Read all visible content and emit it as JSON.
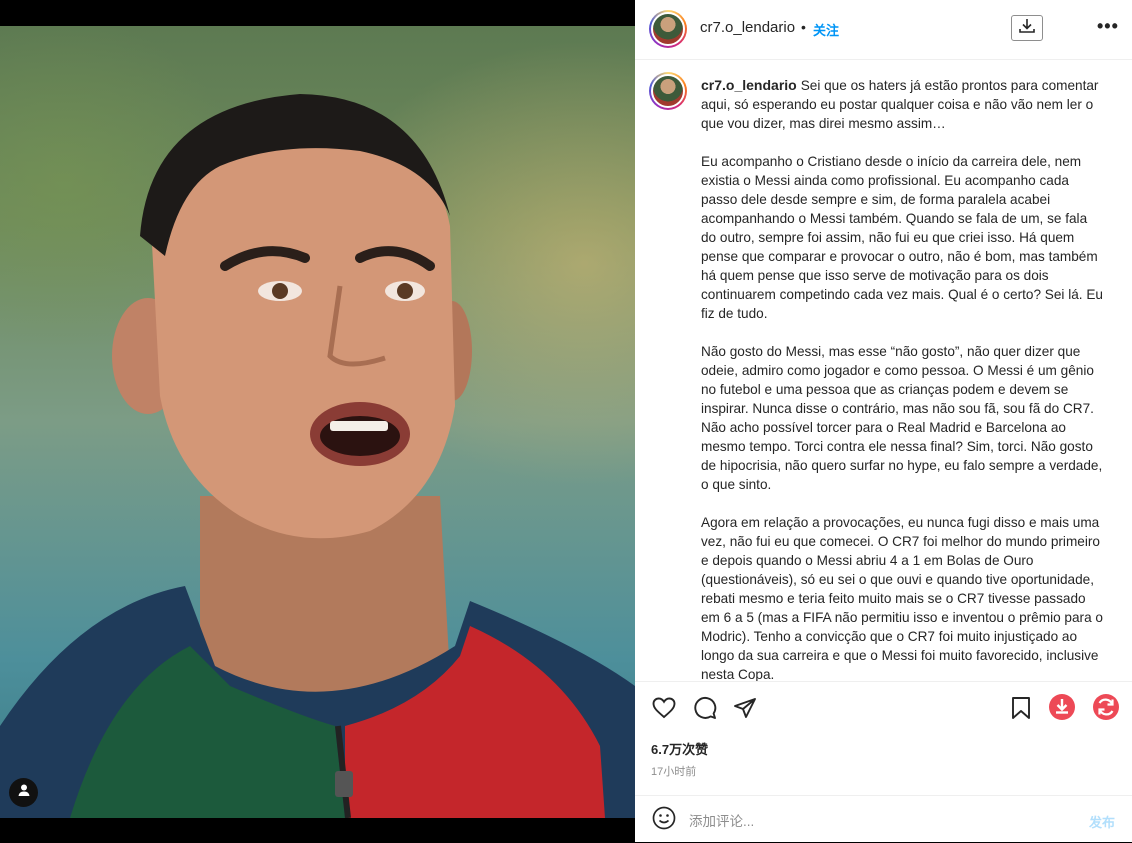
{
  "post": {
    "username": "cr7.o_lendario",
    "separator": "•",
    "follow_label": "关注",
    "more_label": "•••",
    "caption_paragraphs": [
      "Sei que os haters já estão prontos para comentar aqui, só esperando eu postar qualquer coisa e não vão nem ler o que vou dizer, mas direi mesmo assim…",
      "Eu acompanho o Cristiano desde o início da carreira dele, nem existia o Messi ainda como profissional. Eu acompanho cada passo dele desde sempre e sim, de forma paralela acabei acompanhando o Messi também. Quando se fala de um, se fala do outro, sempre foi assim, não fui eu que criei isso. Há quem pense que comparar e provocar o outro, não é bom, mas também há quem pense que isso serve de motivação para os dois continuarem competindo cada vez mais. Qual é o certo? Sei lá. Eu fiz de tudo.",
      "Não gosto do Messi, mas esse “não gosto”, não quer dizer que odeie, admiro como jogador e como pessoa. O Messi é um gênio no futebol e uma pessoa que as crianças podem e devem se inspirar. Nunca disse o contrário, mas não sou fã, sou fã do CR7. Não acho possível torcer para o Real Madrid e Barcelona ao mesmo tempo. Torci contra ele nessa final? Sim, torci. Não gosto de hipocrisia, não quero surfar no hype, eu falo sempre a verdade, o que sinto.",
      "Agora em relação a provocações, eu nunca fugi disso e mais uma vez, não fui eu que comecei. O CR7 foi melhor do mundo primeiro e depois quando o Messi abriu 4 a 1 em Bolas de Ouro (questionáveis), só eu sei o que ouvi e quando tive oportunidade, rebati mesmo e teria feito muito mais se o CR7 tivesse passado em 6 a 5 (mas a FIFA não permitiu isso e inventou o prêmio para o Modric). Tenho a convicção que o CR7 foi muito injustiçado ao longo da sua carreira e que o Messi foi muito favorecido, inclusive nesta Copa."
    ],
    "likes": "6.7万次赞",
    "timestamp": "17小时前"
  },
  "comment": {
    "placeholder": "添加评论...",
    "post_label": "发布"
  },
  "icons": {
    "like": "heart-icon",
    "comment": "comment-icon",
    "share": "send-icon",
    "save": "bookmark-icon",
    "download": "download-icon",
    "refresh": "refresh-icon",
    "emoji": "emoji-icon",
    "tagged_user": "user-icon"
  },
  "colors": {
    "follow": "#0095f6",
    "download_button": "#ed4956",
    "refresh_button": "#ed4956",
    "post_disabled": "#b2dffc"
  }
}
